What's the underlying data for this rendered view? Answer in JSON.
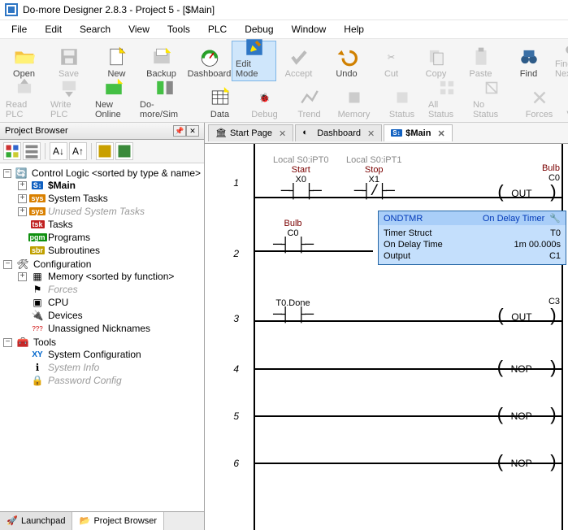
{
  "titlebar": {
    "title": "Do-more Designer 2.8.3 - Project 5 - [$Main]"
  },
  "menubar": {
    "items": [
      "File",
      "Edit",
      "Search",
      "View",
      "Tools",
      "PLC",
      "Debug",
      "Window",
      "Help"
    ]
  },
  "toolbar_row1": {
    "open": "Open",
    "save": "Save",
    "new": "New",
    "backup": "Backup",
    "dashboard": "Dashboard",
    "edit_mode": "Edit Mode",
    "accept": "Accept",
    "undo": "Undo",
    "cut": "Cut",
    "copy": "Copy",
    "paste": "Paste",
    "find": "Find",
    "find_next": "Find Next"
  },
  "toolbar_row2": {
    "read_plc": "Read PLC",
    "write_plc": "Write PLC",
    "new_online": "New Online",
    "domore_sim": "Do-more/Sim",
    "data": "Data",
    "debug": "Debug",
    "trend": "Trend",
    "memory": "Memory",
    "status": "Status",
    "all_status": "All Status",
    "no_status": "No Status",
    "forces": "Forces",
    "value": "V"
  },
  "proj_browser": {
    "title": "Project Browser",
    "root_label": "Control Logic <sorted by type & name>",
    "main": "$Main",
    "system_tasks": "System Tasks",
    "unused_system_tasks": "Unused System Tasks",
    "tasks": "Tasks",
    "programs": "Programs",
    "subroutines": "Subroutines",
    "configuration": "Configuration",
    "memory": "Memory <sorted by function>",
    "forces": "Forces",
    "cpu": "CPU",
    "devices": "Devices",
    "unassigned": "Unassigned Nicknames",
    "tools": "Tools",
    "sys_config": "System Configuration",
    "sys_info": "System Info",
    "pwd_config": "Password Config",
    "tabs": {
      "launchpad": "Launchpad",
      "project_browser": "Project Browser"
    }
  },
  "doc_tabs": {
    "start_page": "Start Page",
    "dashboard": "Dashboard",
    "main": "$Main"
  },
  "ladder": {
    "r1": {
      "num": "1",
      "c1_io": "Local S0:iPT0",
      "c1_alias": "Start",
      "c1_addr": "X0",
      "c2_io": "Local S0:iPT1",
      "c2_alias": "Stop",
      "c2_addr": "X1",
      "out_alias": "Bulb",
      "out_addr": "C0",
      "out_op": "OUT"
    },
    "r2": {
      "num": "2",
      "c1_alias": "Bulb",
      "c1_addr": "C0",
      "timer": {
        "inst": "ONDTMR",
        "title": "On Delay Timer",
        "rows": [
          {
            "k": "Timer Struct",
            "v": "T0"
          },
          {
            "k": "On Delay Time",
            "v": "1m 00.000s"
          },
          {
            "k": "Output",
            "v": "C1"
          }
        ]
      }
    },
    "r3": {
      "num": "3",
      "c1_addr": "T0.Done",
      "out_addr": "C3",
      "out_op": "OUT"
    },
    "r4": {
      "num": "4",
      "out_op": "NOP"
    },
    "r5": {
      "num": "5",
      "out_op": "NOP"
    },
    "r6": {
      "num": "6",
      "out_op": "NOP"
    }
  }
}
